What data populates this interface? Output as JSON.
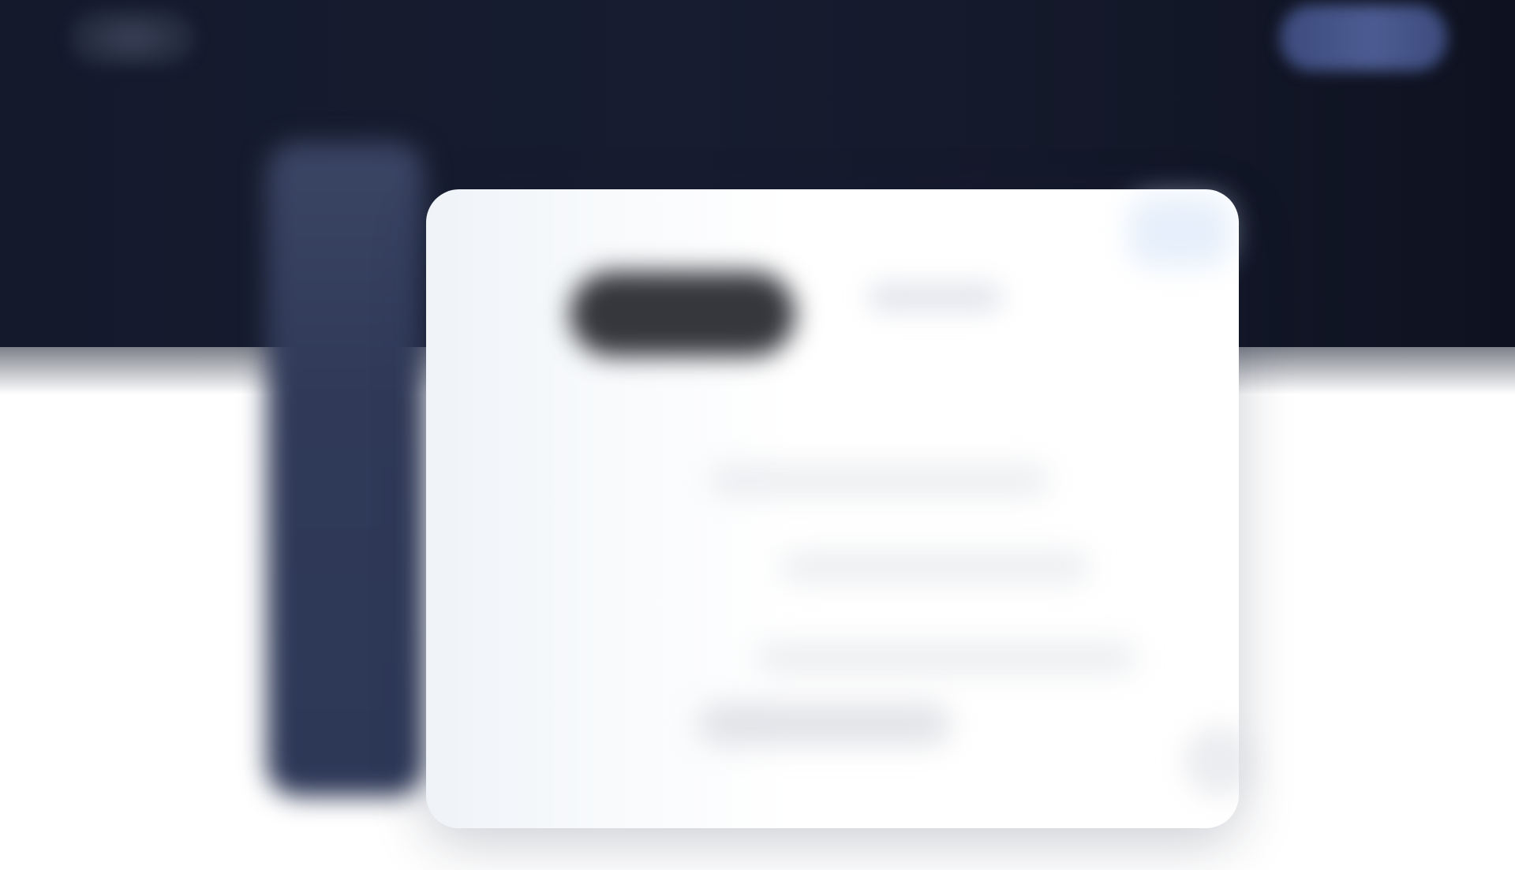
{
  "colors": {
    "hero_background": "#141a2c",
    "side_rail": "#303a58",
    "header_button": "#4c5c92",
    "card_background": "#ffffff",
    "heading_pill": "#35373d"
  },
  "header": {
    "logo_icon": "brand-logo-icon",
    "cta_label": ""
  },
  "main": {
    "heading": "",
    "subheading": "",
    "paragraphs": [
      "",
      "",
      ""
    ],
    "footer_link": ""
  }
}
